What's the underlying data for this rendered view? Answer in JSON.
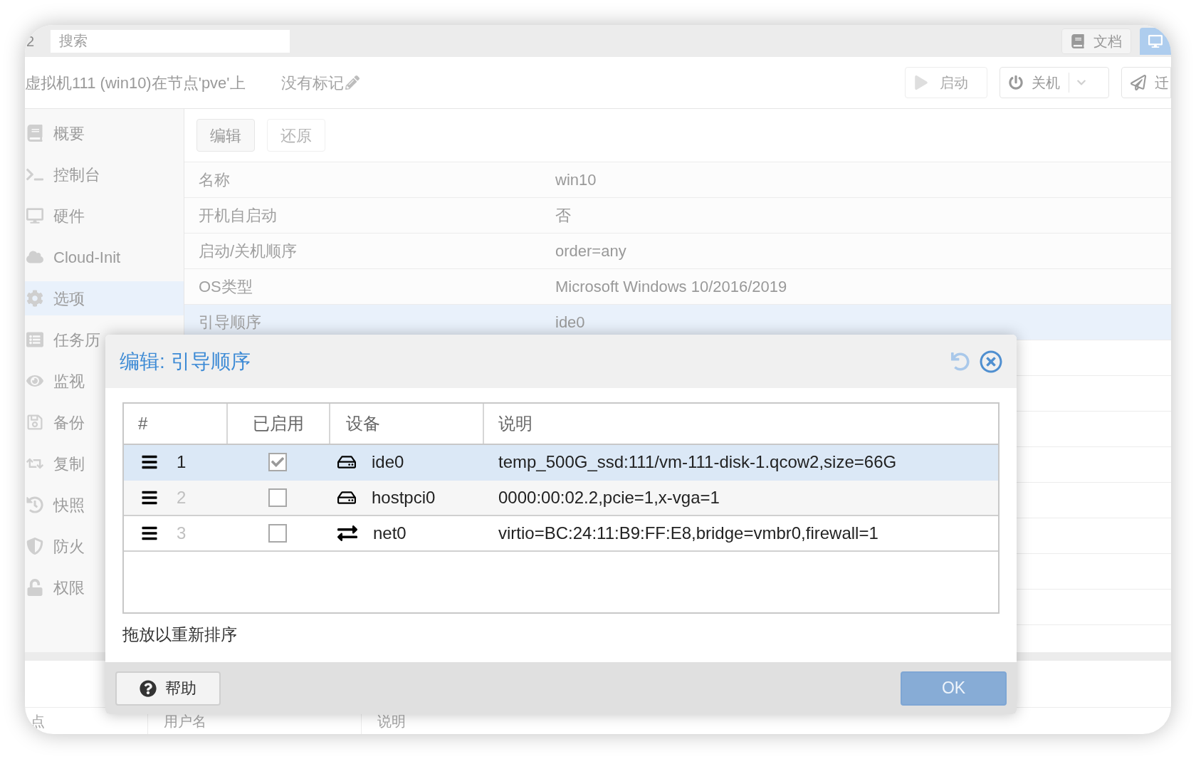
{
  "topbar": {
    "version_fragment": "2",
    "search": {
      "placeholder": "搜索"
    },
    "docs_button": "文档"
  },
  "header": {
    "title": "虚拟机111 (win10)在节点'pve'上",
    "tags": "没有标记",
    "buttons": [
      {
        "label": "启动",
        "kind": "start"
      },
      {
        "label": "关机",
        "kind": "shutdown"
      },
      {
        "label": "迁",
        "kind": "migrate"
      }
    ]
  },
  "sidebar": {
    "items": [
      {
        "label": "概要",
        "kind": "summary",
        "selected": false
      },
      {
        "label": "控制台",
        "kind": "console",
        "selected": false
      },
      {
        "label": "硬件",
        "kind": "hardware",
        "selected": false
      },
      {
        "label": "Cloud-Init",
        "kind": "cloud",
        "selected": false
      },
      {
        "label": "选项",
        "kind": "options",
        "selected": true
      },
      {
        "label": "任务历",
        "kind": "tasks",
        "selected": false
      },
      {
        "label": "监视",
        "kind": "monitor",
        "selected": false
      },
      {
        "label": "备份",
        "kind": "backup",
        "selected": false
      },
      {
        "label": "复制",
        "kind": "replication",
        "selected": false
      },
      {
        "label": "快照",
        "kind": "snapshots",
        "selected": false
      },
      {
        "label": "防火",
        "kind": "firewall",
        "selected": false
      },
      {
        "label": "权限",
        "kind": "permissions",
        "selected": false
      }
    ]
  },
  "toolbar": {
    "buttons": [
      {
        "label": "编辑",
        "disabled": false
      },
      {
        "label": "还原",
        "disabled": true
      }
    ]
  },
  "options": {
    "rows": [
      {
        "name": "名称",
        "value": "win10",
        "selected": false
      },
      {
        "name": "开机自启动",
        "value": "否",
        "selected": false
      },
      {
        "name": "启动/关机顺序",
        "value": "order=any",
        "selected": false
      },
      {
        "name": "OS类型",
        "value": "Microsoft Windows 10/2016/2019",
        "selected": false
      },
      {
        "name": "引导顺序",
        "value": "ide0",
        "selected": true
      }
    ]
  },
  "bottom_panel": {
    "columns": [
      "点",
      "用户名",
      "说明"
    ]
  },
  "dialog": {
    "title": "编辑: 引导顺序",
    "columns": [
      "#",
      "已启用",
      "设备",
      "说明"
    ],
    "rows": [
      {
        "number": "1",
        "enabled": true,
        "kind": "disk",
        "device": "ide0",
        "description": "temp_500G_ssd:111/vm-111-disk-1.qcow2,size=66G",
        "selected": true
      },
      {
        "number": "2",
        "enabled": false,
        "kind": "disk",
        "device": "hostpci0",
        "description": "0000:00:02.2,pcie=1,x-vga=1",
        "selected": false
      },
      {
        "number": "3",
        "enabled": false,
        "kind": "network",
        "device": "net0",
        "description": "virtio=BC:24:11:B9:FF:E8,bridge=vmbr0,firewall=1",
        "selected": false
      }
    ],
    "hint": "拖放以重新排序",
    "help_button": "帮助",
    "ok_button": "OK"
  }
}
